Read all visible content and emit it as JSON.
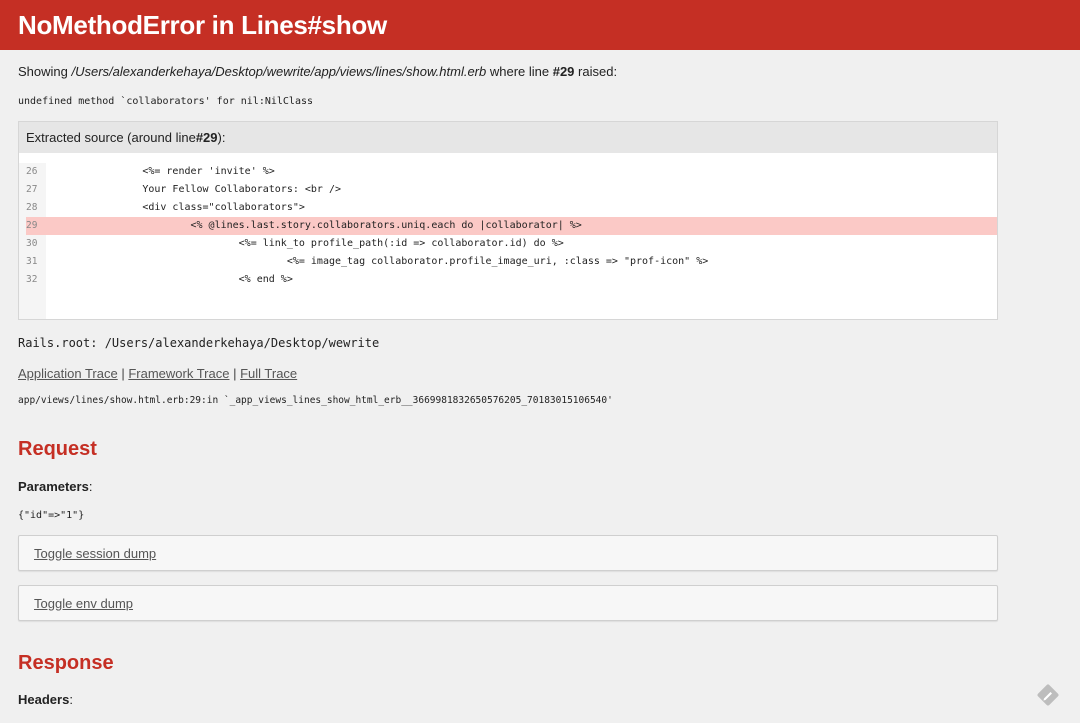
{
  "header": {
    "title": "NoMethodError in Lines#show"
  },
  "showing": {
    "prefix": "Showing ",
    "path": "/Users/alexanderkehaya/Desktop/wewrite/app/views/lines/show.html.erb",
    "middle": " where line ",
    "line": "#29",
    "suffix": " raised:"
  },
  "error_message": "undefined method `collaborators' for nil:NilClass",
  "source": {
    "title_prefix": "Extracted source (around line ",
    "title_line": "#29",
    "title_suffix": "):",
    "lines": [
      {
        "num": "26",
        "code": "                <%= render 'invite' %>"
      },
      {
        "num": "27",
        "code": "                Your Fellow Collaborators: <br />"
      },
      {
        "num": "28",
        "code": "                <div class=\"collaborators\">"
      },
      {
        "num": "29",
        "code": "                        <% @lines.last.story.collaborators.uniq.each do |collaborator| %>"
      },
      {
        "num": "30",
        "code": "                                <%= link_to profile_path(:id => collaborator.id) do %>"
      },
      {
        "num": "31",
        "code": "                                        <%= image_tag collaborator.profile_image_uri, :class => \"prof-icon\" %>"
      },
      {
        "num": "32",
        "code": "                                <% end %>"
      }
    ],
    "highlight_line": "29"
  },
  "rails_root": "Rails.root: /Users/alexanderkehaya/Desktop/wewrite",
  "traces": {
    "application": "Application Trace",
    "framework": "Framework Trace",
    "full": "Full Trace",
    "separator": " | "
  },
  "trace_line": "app/views/lines/show.html.erb:29:in `_app_views_lines_show_html_erb__3669981832650576205_70183015106540'",
  "request": {
    "heading": "Request",
    "params_label": "Parameters",
    "params_colon": ":",
    "params_value": "{\"id\"=>\"1\"}",
    "toggle_session": "Toggle session dump",
    "toggle_env": "Toggle env dump"
  },
  "response": {
    "heading": "Response",
    "headers_label": "Headers",
    "headers_colon": ":"
  },
  "colors": {
    "header_bg": "#c52f24",
    "heading": "#c52f24",
    "highlight": "#fbc9c6"
  },
  "icons": {
    "corner": "pencil-badge-icon"
  }
}
